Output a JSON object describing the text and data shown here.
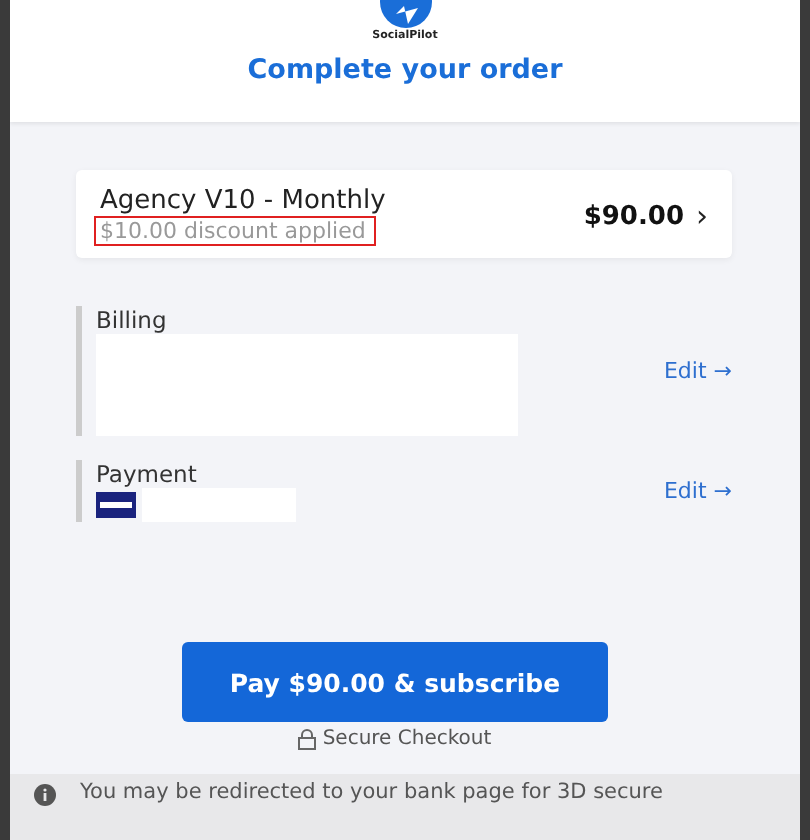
{
  "brand": {
    "name": "SocialPilot"
  },
  "title": "Complete your order",
  "plan": {
    "name": "Agency V10 - Monthly",
    "discount": "$10.00 discount applied",
    "price": "$90.00",
    "chevron": "›"
  },
  "sections": [
    {
      "kind": "billing",
      "label": "Billing",
      "edit": "Edit →"
    },
    {
      "kind": "payment",
      "label": "Payment",
      "edit": "Edit →"
    }
  ],
  "pay_button": "Pay $90.00 & subscribe",
  "secure_note": "Secure Checkout",
  "notice": "You may be redirected to your bank page for 3D secure"
}
